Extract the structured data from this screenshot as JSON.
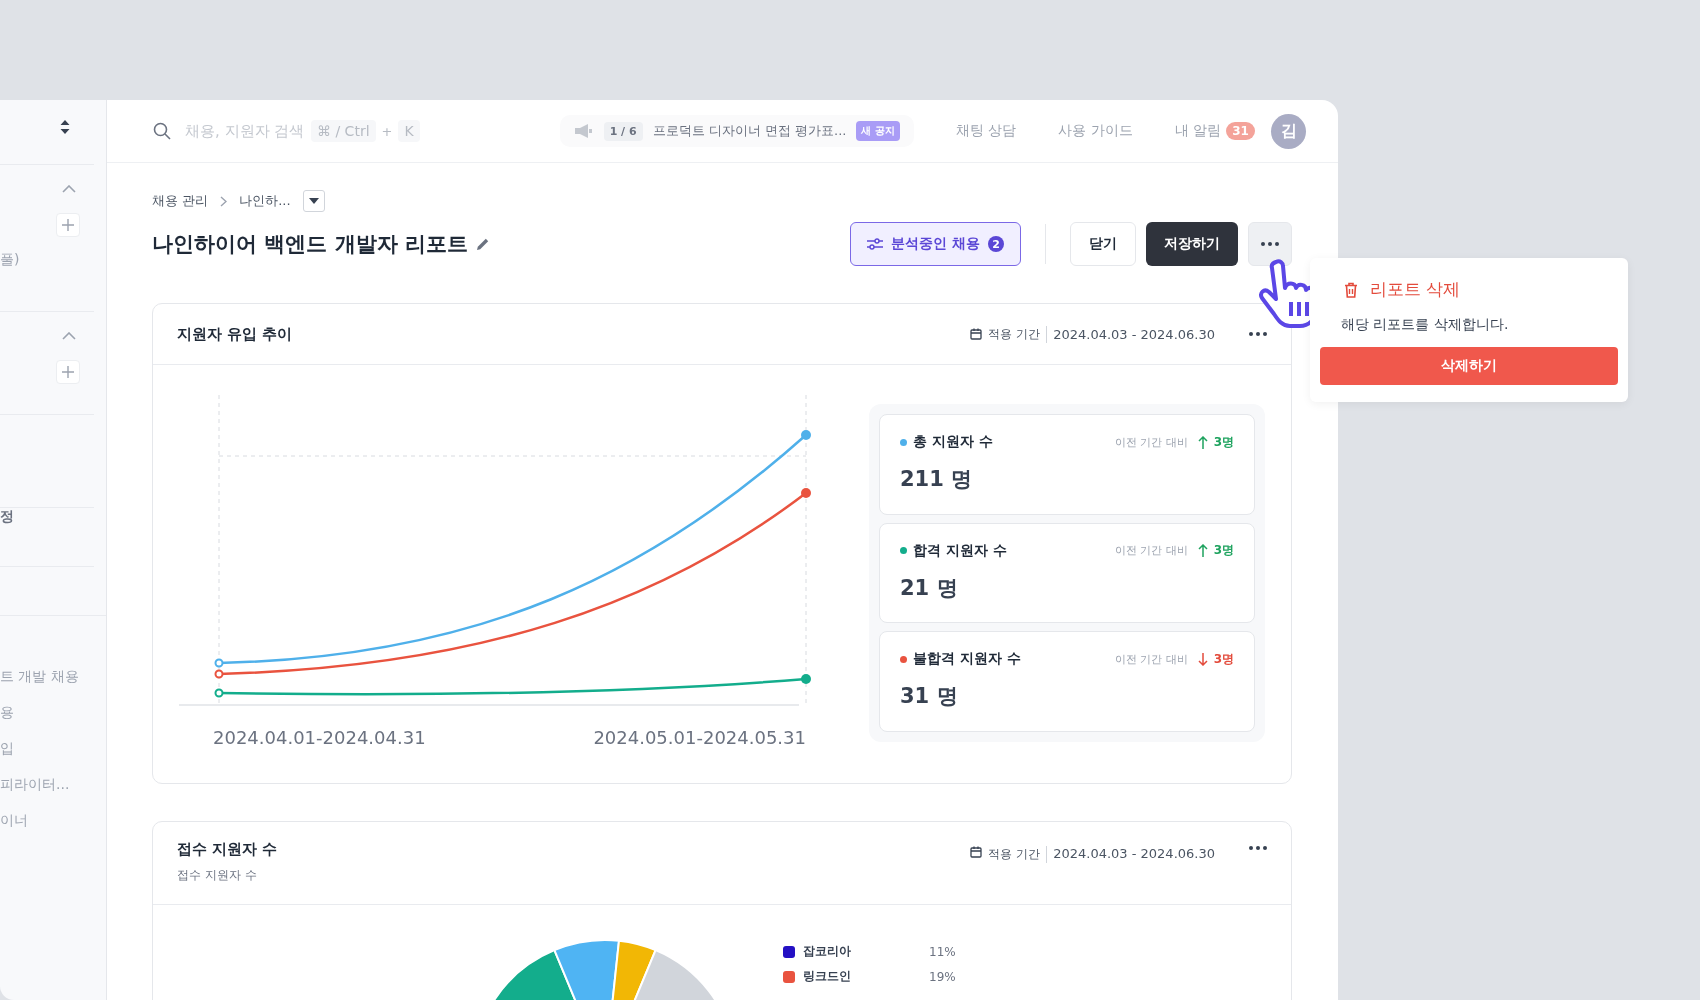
{
  "sidebar": {
    "items": [
      {
        "label": "풀)",
        "bold": false
      },
      {
        "label": "정",
        "bold": true
      },
      {
        "label": "트 개발 채용",
        "bold": false
      },
      {
        "label": "용",
        "bold": false
      },
      {
        "label": "입",
        "bold": false
      },
      {
        "label": "피라이터...",
        "bold": false
      },
      {
        "label": "이너",
        "bold": false
      }
    ]
  },
  "topbar": {
    "search": {
      "placeholder": "채용, 지원자 검색",
      "shortcut": [
        "⌘ / Ctrl",
        "+",
        "K"
      ]
    },
    "notice": {
      "counter": "1 / 6",
      "text": "프로덕트 디자이너 면접 평가표...",
      "badge": "새 공지"
    },
    "links": [
      "채팅 상담",
      "사용 가이드"
    ],
    "alerts": {
      "label": "내 알림",
      "count": "31"
    },
    "avatar": "김"
  },
  "breadcrumb": [
    "채용 관리",
    "나인하..."
  ],
  "title": "나인하이어 백엔드 개발자 리포트",
  "actions": {
    "filter": {
      "label": "분석중인 채용",
      "count": "2"
    },
    "close": "닫기",
    "save": "저장하기"
  },
  "trend_card": {
    "title": "지원자 유입 추이",
    "period_label": "적용 기간",
    "period": "2024.04.03 - 2024.06.30",
    "x_labels": [
      "2024.04.01-2024.04.31",
      "2024.05.01-2024.05.31"
    ],
    "stats": [
      {
        "name": "총 지원자 수",
        "color": "#4fb0ea",
        "compare": "이전 기간 대비",
        "kind": "up",
        "delta": "3명",
        "value": "211 명"
      },
      {
        "name": "합격 지원자 수",
        "color": "#13ad8c",
        "compare": "이전 기간 대비",
        "kind": "up",
        "delta": "3명",
        "value": "21 명"
      },
      {
        "name": "불합격 지원자 수",
        "color": "#e9533f",
        "compare": "이전 기간 대비",
        "kind": "down",
        "delta": "3명",
        "value": "31 명"
      }
    ]
  },
  "source_card": {
    "title": "접수 지원자 수",
    "subtitle": "접수 지원자 수",
    "period_label": "적용 기간",
    "period": "2024.04.03 - 2024.06.30",
    "legend": [
      {
        "name": "잡코리아",
        "color": "#2410c4",
        "share": "11%"
      },
      {
        "name": "링크드인",
        "color": "#e9533f",
        "share": "19%"
      }
    ]
  },
  "popup": {
    "title": "리포트 삭제",
    "text": "해당 리포트를 삭제합니다.",
    "button": "삭제하기"
  }
}
